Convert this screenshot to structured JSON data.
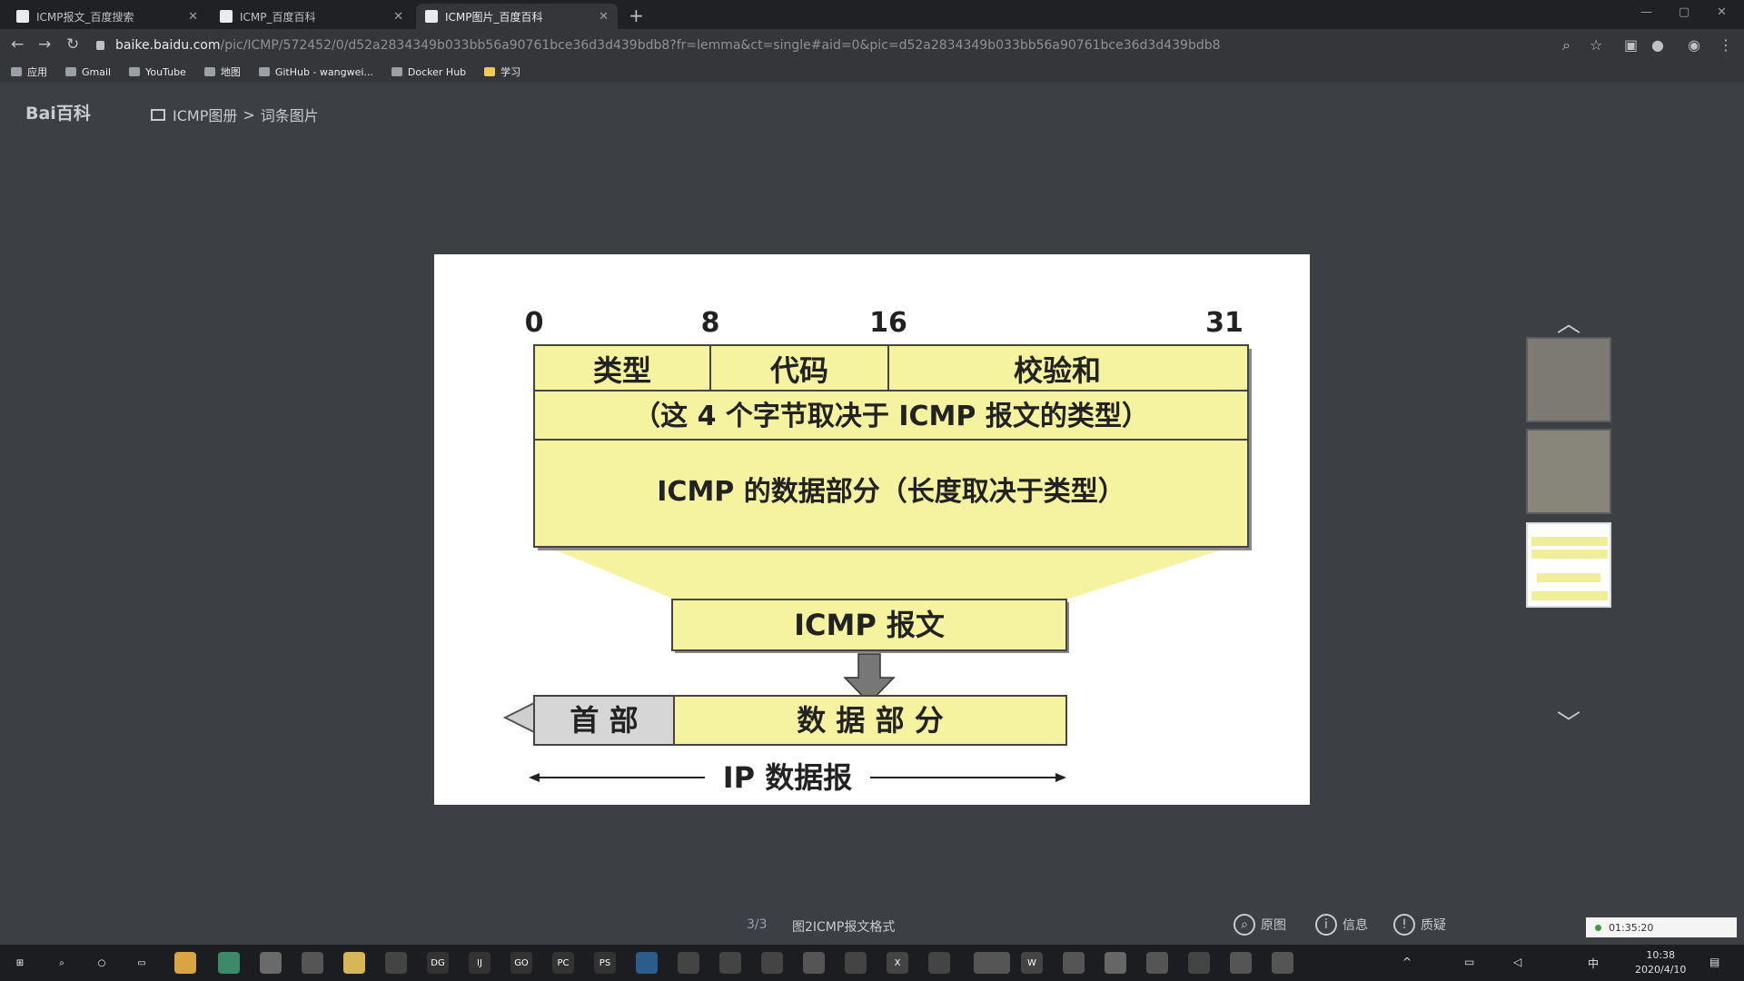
{
  "browser": {
    "tabs": [
      {
        "label": "ICMP报文_百度搜索",
        "active": false
      },
      {
        "label": "ICMP_百度百科",
        "active": false
      },
      {
        "label": "ICMP图片_百度百科",
        "active": true
      }
    ],
    "url_host": "baike.baidu.com",
    "url_path": "/pic/ICMP/572452/0/d52a2834349b033bb56a90761bce36d3d439bdb8?fr=lemma&ct=single#aid=0&pic=d52a2834349b033bb56a90761bce36d3d439bdb8",
    "bookmarks": [
      "应用",
      "Gmail",
      "YouTube",
      "地图",
      "GitHub - wangwei...",
      "Docker Hub",
      "学习"
    ]
  },
  "page": {
    "logo": "Bai百科",
    "breadcrumb_album": "ICMP图册",
    "breadcrumb_sep": ">",
    "breadcrumb_current": "词条图片"
  },
  "figure": {
    "bit_labels": [
      "0",
      "8",
      "16",
      "31"
    ],
    "field_type": "类型",
    "field_code": "代码",
    "field_checksum": "校验和",
    "row2": "（这 4 个字节取决于 ICMP 报文的类型）",
    "row3": "ICMP 的数据部分（长度取决于类型）",
    "icmp_message": "ICMP 报文",
    "header": "首 部",
    "data_part": "数 据 部 分",
    "ip_datagram": "IP 数据报"
  },
  "viewer": {
    "counter": "3/3",
    "caption": "图2ICMP报文格式",
    "actions": [
      "原图",
      "信息",
      "质疑"
    ],
    "prev_icon": "^",
    "next_icon": "v"
  },
  "taskbar": {
    "time": "10:38",
    "date": "2020/4/10",
    "timer": "01:35:20",
    "ime": "中"
  },
  "colors": {
    "page_bg": "#3c3f44",
    "figure_fill": "#f5f3a0",
    "figure_frame": "#ffffff",
    "header_fill": "#d6d6d6"
  }
}
